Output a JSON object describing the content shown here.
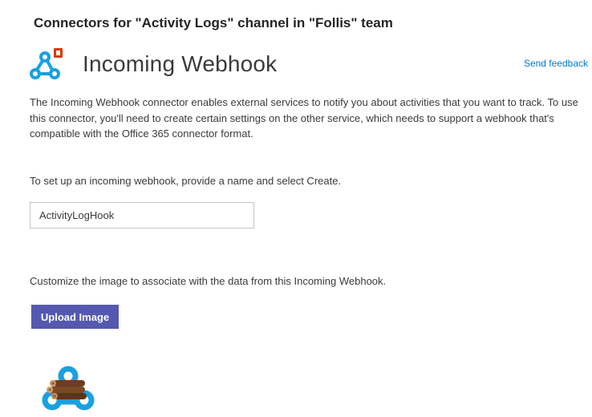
{
  "dialog": {
    "title": "Connectors for \"Activity Logs\" channel in \"Follis\" team"
  },
  "connector": {
    "name": "Incoming Webhook",
    "logo_icon": "webhook-office-icon",
    "send_feedback_label": "Send feedback",
    "description": "The Incoming Webhook connector enables external services to notify you about activities that you want to track. To use this connector, you'll need to create certain settings on the other service, which needs to support a webhook that's compatible with the Office 365 connector format."
  },
  "setup": {
    "instruction": "To set up an incoming webhook, provide a name and select Create.",
    "name_value": "ActivityLogHook"
  },
  "image_section": {
    "instruction": "Customize the image to associate with the data from this Incoming Webhook.",
    "upload_label": "Upload Image",
    "preview_icon": "webhook-logs-image"
  },
  "colors": {
    "webhook_blue": "#1aa0e0",
    "office_red": "#d83b01",
    "button_purple": "#5558af",
    "link_blue": "#0078d4"
  }
}
